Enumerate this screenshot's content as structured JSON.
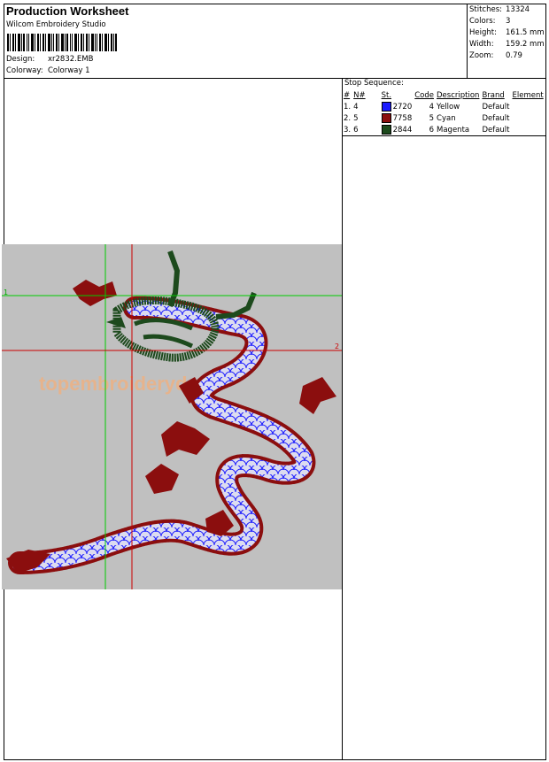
{
  "header": {
    "title": "Production Worksheet",
    "software": "Wilcom Embroidery Studio",
    "design_label": "Design:",
    "design_value": "xr2832.EMB",
    "colorway_label": "Colorway:",
    "colorway_value": "Colorway 1"
  },
  "stats": [
    {
      "label": "Stitches:",
      "value": "13324"
    },
    {
      "label": "Colors:",
      "value": "3"
    },
    {
      "label": "Height:",
      "value": "161.5 mm"
    },
    {
      "label": "Width:",
      "value": "159.2 mm"
    },
    {
      "label": "Zoom:",
      "value": "0.79"
    }
  ],
  "stop_sequence": {
    "title": "Stop Sequence:",
    "columns": [
      "#",
      "N#",
      "St.",
      "Code",
      "Description",
      "Brand",
      "Element"
    ],
    "rows": [
      {
        "num": "1.",
        "n": "4",
        "color": "#1a1aff",
        "st": "2720",
        "code": "4",
        "description": "Yellow",
        "brand": "Default",
        "element": ""
      },
      {
        "num": "2.",
        "n": "5",
        "color": "#8b0e0e",
        "st": "7758",
        "code": "5",
        "description": "Cyan",
        "brand": "Default",
        "element": ""
      },
      {
        "num": "3.",
        "n": "6",
        "color": "#1d4a1d",
        "st": "2844",
        "code": "6",
        "description": "Magenta",
        "brand": "Default",
        "element": ""
      }
    ]
  },
  "canvas": {
    "background": "#c0c0c0",
    "marker_1": "1",
    "marker_2": "2",
    "watermark": "topembroideryd...",
    "crosshair_green": "#00cc00",
    "crosshair_red": "#cc0000"
  }
}
